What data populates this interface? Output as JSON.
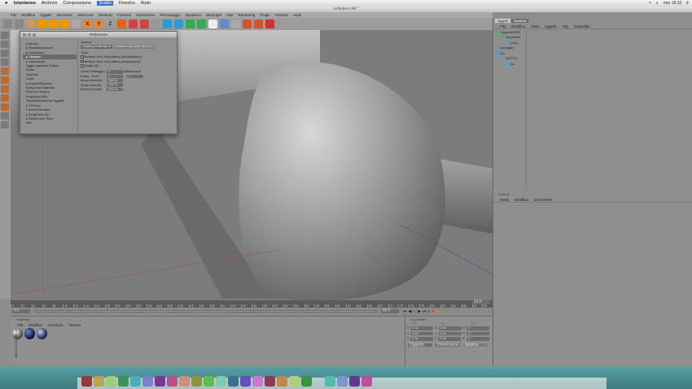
{
  "mac_menubar": {
    "items": [
      "Istantanea",
      "Archivio",
      "Composizione",
      "Scatto",
      "Finestra",
      "Aiuto"
    ],
    "selected": "Scatto",
    "clock": "mer 18.32"
  },
  "window": {
    "title": "cellulare.c4d *"
  },
  "c4d_menu": [
    "File",
    "Modifica",
    "Oggetti",
    "Strumenti",
    "Selezione",
    "Struttura",
    "Funzioni",
    "Animazione",
    "Personaggio",
    "Dynamics",
    "MoGraph",
    "Hair",
    "Rendering",
    "Plugin",
    "Finestra",
    "Aiuto"
  ],
  "toolbar": {
    "icons": [
      "undo-icon",
      "redo-icon",
      "select-icon",
      "move-icon",
      "scale-icon",
      "rotate-icon",
      "recent-tool-icon",
      "x-axis-icon",
      "y-axis-icon",
      "z-axis-icon",
      "world-coord-icon",
      "render-view-icon",
      "render-picture-icon",
      "render-settings-icon",
      "cube-icon",
      "nurbs-icon",
      "generator-icon",
      "deformer-icon",
      "scene-icon",
      "light-icon",
      "camera-icon",
      "joint-icon",
      "bone-icon",
      "record-icon"
    ],
    "labels": {
      "x": "X",
      "y": "Y",
      "z": "Z"
    }
  },
  "preferences": {
    "title": "Preferenze",
    "categories": [
      {
        "label": "Comune",
        "expand": false
      },
      {
        "label": "Renderizzazione",
        "expand": true
      },
      {
        "label": "Interfaccia",
        "expand": true
      },
      {
        "label": "Viewport",
        "expand": true,
        "selected": true
      },
      {
        "label": "Documento",
        "expand": true
      },
      {
        "label": "Aggiornamento Online",
        "expand": false
      },
      {
        "label": "Audio",
        "expand": false
      },
      {
        "label": "Sistema",
        "expand": false
      },
      {
        "label": "Unità",
        "expand": false
      },
      {
        "label": "Importa/Esporta",
        "expand": true
      },
      {
        "label": "Anteprima Materiali",
        "expand": false
      },
      {
        "label": "Percorsi Texture",
        "expand": false
      },
      {
        "label": "Projection Man",
        "expand": false
      },
      {
        "label": "Timeline/Gestione Oggetti",
        "expand": false
      },
      {
        "label": "XPresso",
        "expand": true
      },
      {
        "label": "Content Browser",
        "expand": false
      },
      {
        "label": "BodyPaint 3D",
        "expand": true
      },
      {
        "label": "Sketch and Toon",
        "expand": true
      },
      {
        "label": "Hair",
        "expand": false
      }
    ],
    "opzioni_label": "Opzioni",
    "shading_select": "Shading Software",
    "reset_button": "Mostra Capacità OpenGL",
    "vista_label": "Vista",
    "checkboxes": [
      "Refresh Solo Vista Attiva (Modellazione)",
      "Refresh Solo Vista Attiva (Animazione)",
      "Griglia 3D"
    ],
    "fields": [
      {
        "label": "Limite Ridisegno",
        "value": "0",
        "unit": "Millisecondi"
      },
      {
        "label": "Editor : Pixel",
        "value": "1",
        "value2": "1"
      },
      {
        "label": "Muovi Velocità",
        "value": "100 %"
      },
      {
        "label": "Scala Velocità",
        "value": "100 %"
      },
      {
        "label": "Ruota Velocità",
        "value": "100 %"
      }
    ]
  },
  "object_manager": {
    "tabs": [
      "Oggetti",
      "Struttura"
    ],
    "menu": [
      "File",
      "Modifica",
      "Vista",
      "Oggetti",
      "Tag",
      "Segnalibri"
    ],
    "objects": [
      {
        "name": "HyperNURBS",
        "indent": 0,
        "color": "#30c060"
      },
      {
        "name": "Simmetria",
        "indent": 1,
        "color": "#30c060"
      },
      {
        "name": "Cubo",
        "indent": 2,
        "color": "#40a0e0"
      },
      {
        "name": "immagini",
        "indent": 0,
        "color": "#888888"
      },
      {
        "name": "tvo",
        "indent": 0,
        "color": "#40a0e0"
      },
      {
        "name": "SOTTO",
        "indent": 1,
        "color": "#40a0e0"
      },
      {
        "name": "tvo",
        "indent": 2,
        "color": "#40a0e0"
      }
    ]
  },
  "attributes": {
    "title": "Attributi",
    "menu": [
      "Modo",
      "Modifica",
      "Dati Utente"
    ]
  },
  "timeline": {
    "ticks": [
      "0",
      "2",
      "4",
      "6",
      "8",
      "10",
      "12",
      "14",
      "16",
      "18",
      "20",
      "22",
      "24",
      "26",
      "28",
      "30",
      "32",
      "34",
      "36",
      "38",
      "40",
      "42",
      "44",
      "46",
      "48",
      "50",
      "52",
      "54",
      "56",
      "58",
      "60",
      "62",
      "64",
      "66",
      "68",
      "70",
      "72",
      "74",
      "76",
      "78",
      "80",
      "82",
      "84",
      "86",
      "88",
      "90"
    ],
    "current": "12 F",
    "start": "0 F",
    "end": "90 F"
  },
  "materials": {
    "title": "Materiali",
    "menu": [
      "File",
      "Modifica",
      "Funzione",
      "Texture"
    ],
    "count": 3
  },
  "coordinates": {
    "title": "Coordinate",
    "headers": [
      "Pos",
      "Dim",
      "Rot"
    ],
    "rows": [
      {
        "a": "X",
        "av": "0 cm",
        "b": "X",
        "bv": "0 cm",
        "c": "H",
        "cv": "0 °"
      },
      {
        "a": "Y",
        "av": "0 cm",
        "b": "Y",
        "bv": "0 cm",
        "c": "P",
        "cv": "0 °"
      },
      {
        "a": "Z",
        "av": "0 cm",
        "b": "Z",
        "bv": "0 cm",
        "c": "B",
        "cv": "0 °"
      }
    ],
    "mode_select": "Oggetto",
    "size_select": "Dimensione",
    "apply_button": "Applica"
  },
  "side_label": "MAXON CINEMA 4D"
}
